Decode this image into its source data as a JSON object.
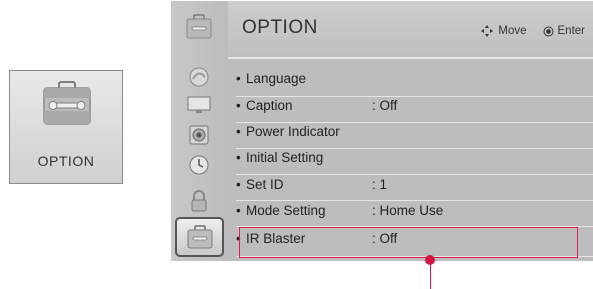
{
  "tile": {
    "label": "OPTION",
    "icon": "toolbox-icon"
  },
  "header": {
    "title": "OPTION",
    "hints": [
      {
        "icon": "dpad-arrows-icon",
        "label": "Move"
      },
      {
        "icon": "enter-button-icon",
        "label": "Enter"
      }
    ]
  },
  "sidebar": {
    "icons": [
      "picture-icon",
      "screen-icon",
      "audio-icon",
      "time-icon",
      "lock-icon",
      "option-icon",
      "network-icon"
    ],
    "selected": "option-icon"
  },
  "menu": {
    "bullet": "•",
    "items": [
      {
        "label": "Language",
        "value": ""
      },
      {
        "label": "Caption",
        "value": ": Off"
      },
      {
        "label": "Power Indicator",
        "value": ""
      },
      {
        "label": "Initial Setting",
        "value": ""
      },
      {
        "label": "Set ID",
        "value": ": 1"
      },
      {
        "label": "Mode Setting",
        "value": ": Home Use"
      },
      {
        "label": "IR Blaster",
        "value": ": Off"
      }
    ],
    "highlighted_index": 6
  },
  "colors": {
    "highlight": "#e21b4a",
    "panel": "#bdbdbd",
    "text": "#222222"
  }
}
